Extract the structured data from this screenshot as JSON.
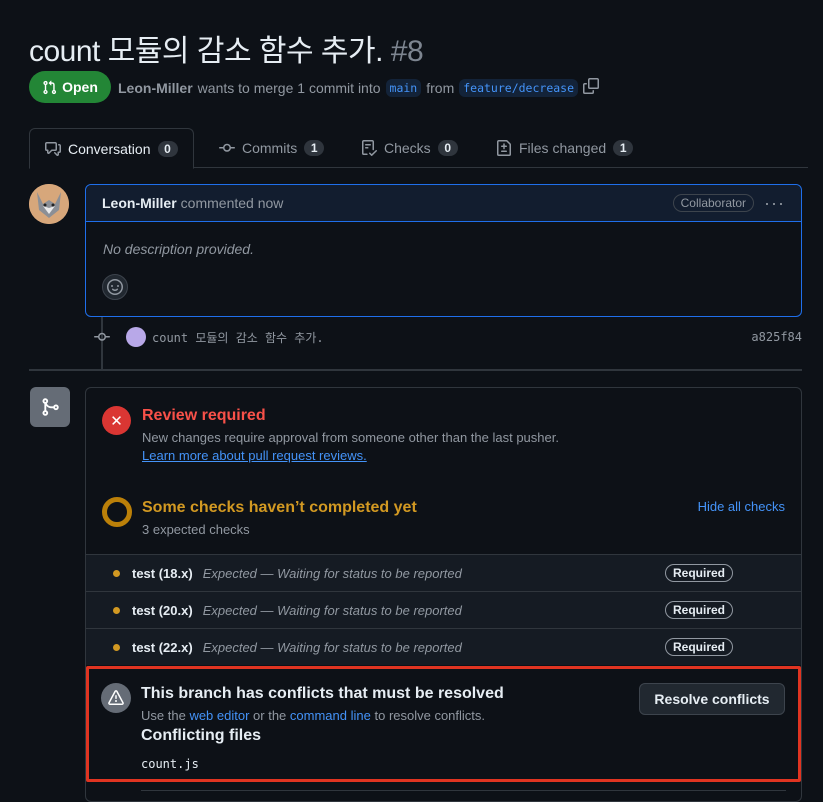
{
  "pr": {
    "title": "count 모듈의 감소 함수 추가.",
    "number": "#8",
    "state": "Open"
  },
  "meta": {
    "author": "Leon-Miller",
    "text_mid": "wants to merge 1 commit into",
    "base": "main",
    "text_from": "from",
    "head": "feature/decrease"
  },
  "tabs": [
    {
      "label": "Conversation",
      "count": "0"
    },
    {
      "label": "Commits",
      "count": "1"
    },
    {
      "label": "Checks",
      "count": "0"
    },
    {
      "label": "Files changed",
      "count": "1"
    }
  ],
  "comment": {
    "author": "Leon-Miller",
    "time": "commented now",
    "badge": "Collaborator",
    "body": "No description provided."
  },
  "commit": {
    "message": "count 모듈의 감소 함수 추가.",
    "sha": "a825f84"
  },
  "review": {
    "title": "Review required",
    "subtitle": "New changes require approval from someone other than the last pusher.",
    "link": "Learn more about pull request reviews."
  },
  "checks_summary": {
    "title": "Some checks haven’t completed yet",
    "subtitle": "3 expected checks",
    "toggle": "Hide all checks"
  },
  "checks": [
    {
      "name": "test (18.x)",
      "status": "Expected — Waiting for status to be reported",
      "badge": "Required"
    },
    {
      "name": "test (20.x)",
      "status": "Expected — Waiting for status to be reported",
      "badge": "Required"
    },
    {
      "name": "test (22.x)",
      "status": "Expected — Waiting for status to be reported",
      "badge": "Required"
    }
  ],
  "conflict": {
    "title": "This branch has conflicts that must be resolved",
    "sub_pre": "Use the",
    "web_editor": "web editor",
    "sub_mid": "or the",
    "command_line": "command line",
    "sub_post": "to resolve conflicts.",
    "files_heading": "Conflicting files",
    "file": "count.js",
    "button": "Resolve conflicts"
  },
  "colors": {
    "open": "#238636",
    "danger": "#da3633",
    "pending": "#d29922",
    "link": "#4493f8",
    "highlight": "#e03421"
  }
}
